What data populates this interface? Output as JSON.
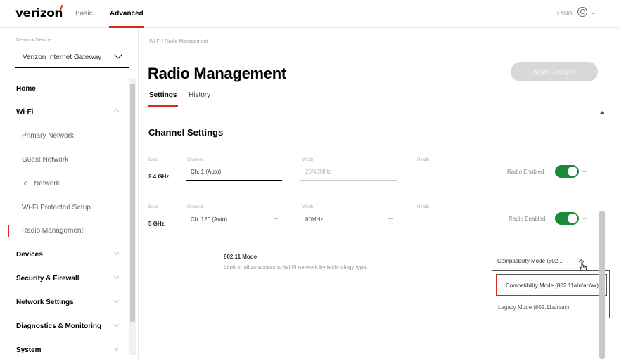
{
  "topbar": {
    "logo": "verizon",
    "nav_basic": "Basic",
    "nav_advanced": "Advanced",
    "lang": "LANG",
    "account_icon": "account-icon",
    "account_chevron": "⌄"
  },
  "sidebar": {
    "device_label": "Network Device",
    "device_select": "Verizon Internet Gateway",
    "items": [
      {
        "label": "Home",
        "type": "section"
      },
      {
        "label": "Wi-Fi",
        "type": "section"
      },
      {
        "label": "Primary Network",
        "type": "sub"
      },
      {
        "label": "Guest Network",
        "type": "sub"
      },
      {
        "label": "IoT Network",
        "type": "sub"
      },
      {
        "label": "Wi-Fi Protected Setup",
        "type": "sub"
      },
      {
        "label": "Radio Management",
        "type": "sub"
      },
      {
        "label": "Devices",
        "type": "section"
      },
      {
        "label": "Security & Firewall",
        "type": "section"
      },
      {
        "label": "Network Settings",
        "type": "section"
      },
      {
        "label": "Diagnostics & Monitoring",
        "type": "section"
      },
      {
        "label": "System",
        "type": "section"
      }
    ]
  },
  "main": {
    "breadcrumb": "Wi-Fi  /  Radio Management",
    "title": "Radio Management",
    "apply_button": "Apply Changes",
    "tabs": [
      {
        "label": "Settings",
        "active": true
      },
      {
        "label": "History",
        "active": false
      }
    ],
    "channel_settings": {
      "title": "Channel Settings",
      "rows": [
        {
          "band_label": "Band",
          "band": "2.4 GHz",
          "channel_label": "Channel",
          "channel": "Ch. 1 (Auto)",
          "width_label": "Width",
          "width": "20/40MHz",
          "health_label": "Health",
          "toggle_label": "Radio Enabled",
          "enabled": true
        },
        {
          "band_label": "Band",
          "band": "5 GHz",
          "channel_label": "Channel",
          "channel": "Ch. 120 (Auto)",
          "width_label": "Width",
          "width": "80MHz",
          "health_label": "Health",
          "toggle_label": "Radio Enabled",
          "enabled": true
        }
      ]
    },
    "mode": {
      "title": "802.11 Mode",
      "description": "Limit or allow access to Wi-Fi network by technology type.",
      "selected": "Compatibility Mode (802...",
      "options": [
        "Compatibility Mode (802.11a/n/ac/ax)",
        "Legacy Mode (802.11a/n/ac)"
      ]
    }
  },
  "colors": {
    "accent": "#d52b1e",
    "toggle_on": "#1a8a36",
    "apply_disabled": "#d8d8d8"
  }
}
